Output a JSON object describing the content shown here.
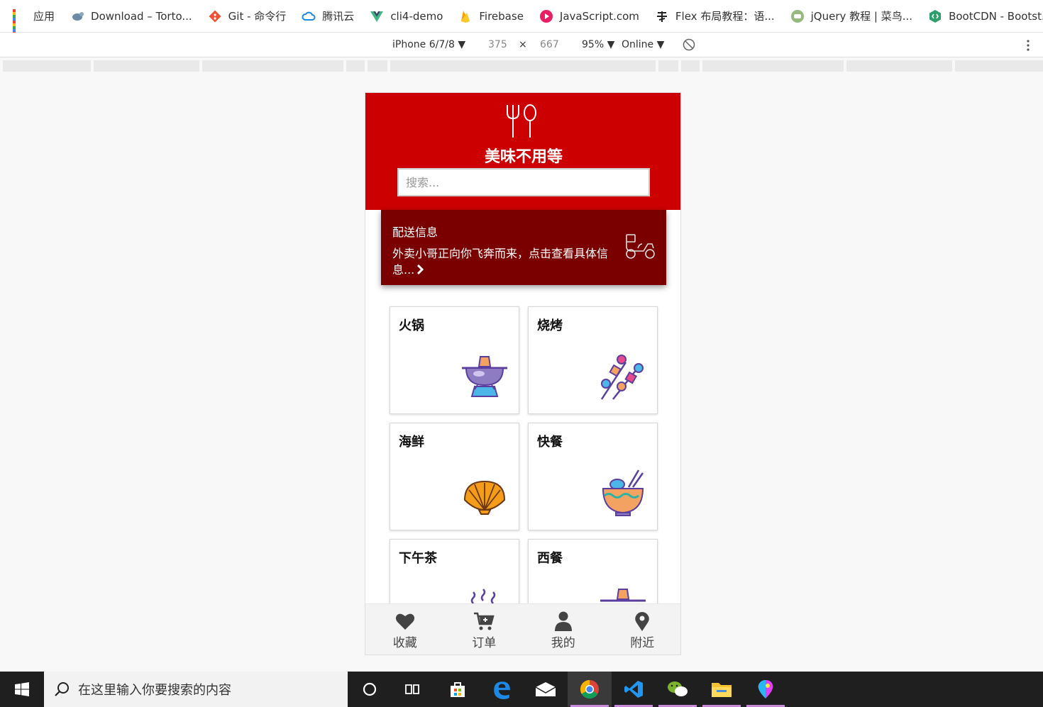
{
  "bookmarks": [
    {
      "label": "应用",
      "icon": "apps-icon"
    },
    {
      "label": "Download – Torto...",
      "icon": "tortoise-icon"
    },
    {
      "label": "Git - 命令行",
      "icon": "git-icon"
    },
    {
      "label": "腾讯云",
      "icon": "cloud-icon"
    },
    {
      "label": "cli4-demo",
      "icon": "vue-icon"
    },
    {
      "label": "Firebase",
      "icon": "firebase-icon"
    },
    {
      "label": "JavaScript.com",
      "icon": "javascript-icon"
    },
    {
      "label": "Flex 布局教程：语...",
      "icon": "ruanyf-icon"
    },
    {
      "label": "jQuery 教程 | 菜鸟...",
      "icon": "runoob-icon"
    },
    {
      "label": "BootCDN - Bootst...",
      "icon": "bootcdn-icon"
    }
  ],
  "device_toolbar": {
    "device": "iPhone 6/7/8",
    "width": "375",
    "times": "×",
    "height": "667",
    "zoom": "95%",
    "network": "Online"
  },
  "app": {
    "brand": "美味不用等",
    "search_placeholder": "搜索...",
    "delivery": {
      "title": "配送信息",
      "text": "外卖小哥正向你飞奔而来，点击查看具体信息..."
    },
    "categories": [
      {
        "name": "火锅",
        "icon": "hotpot-icon"
      },
      {
        "name": "烧烤",
        "icon": "skewers-icon"
      },
      {
        "name": "海鲜",
        "icon": "shell-icon"
      },
      {
        "name": "快餐",
        "icon": "noodle-bowl-icon"
      },
      {
        "name": "下午茶",
        "icon": "tea-icon"
      },
      {
        "name": "西餐",
        "icon": "western-food-icon"
      }
    ],
    "tabs": [
      {
        "label": "收藏",
        "icon": "heart-icon"
      },
      {
        "label": "订单",
        "icon": "cart-icon"
      },
      {
        "label": "我的",
        "icon": "user-icon"
      },
      {
        "label": "附近",
        "icon": "location-pin-icon"
      }
    ]
  },
  "taskbar": {
    "search_placeholder": "在这里输入你要搜索的内容"
  },
  "colors": {
    "header_red": "#cc0000",
    "delivery_dark_red": "#7a0000",
    "tab_icon": "#444444"
  }
}
